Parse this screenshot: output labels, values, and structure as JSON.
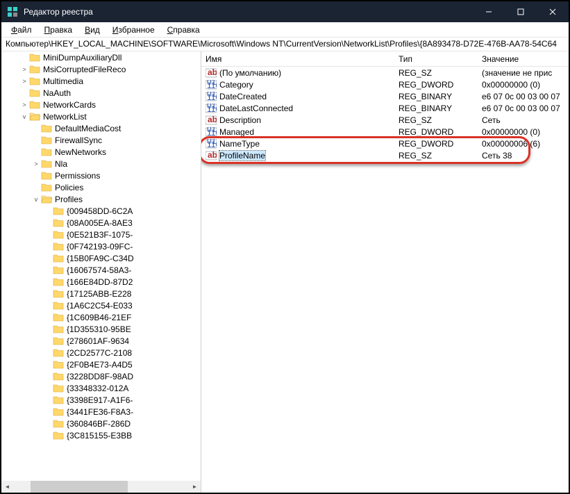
{
  "title": "Редактор реестра",
  "menu": {
    "file": "Файл",
    "edit": "Правка",
    "view": "Вид",
    "favorites": "Избранное",
    "help": "Справка"
  },
  "address": "Компьютер\\HKEY_LOCAL_MACHINE\\SOFTWARE\\Microsoft\\Windows NT\\CurrentVersion\\NetworkList\\Profiles\\{8A893478-D72E-476B-AA78-54C64",
  "columns": {
    "name": "Имя",
    "type": "Тип",
    "value": "Значение"
  },
  "tree": [
    {
      "indent": 8,
      "toggle": "",
      "label": "MiniDumpAuxiliaryDll"
    },
    {
      "indent": 8,
      "toggle": ">",
      "label": "MsiCorruptedFileReco"
    },
    {
      "indent": 8,
      "toggle": ">",
      "label": "Multimedia"
    },
    {
      "indent": 8,
      "toggle": "",
      "label": "NaAuth"
    },
    {
      "indent": 8,
      "toggle": ">",
      "label": "NetworkCards"
    },
    {
      "indent": 8,
      "toggle": "v",
      "label": "NetworkList"
    },
    {
      "indent": 9,
      "toggle": "",
      "label": "DefaultMediaCost"
    },
    {
      "indent": 9,
      "toggle": "",
      "label": "FirewallSync"
    },
    {
      "indent": 9,
      "toggle": "",
      "label": "NewNetworks"
    },
    {
      "indent": 9,
      "toggle": ">",
      "label": "Nla"
    },
    {
      "indent": 9,
      "toggle": "",
      "label": "Permissions"
    },
    {
      "indent": 9,
      "toggle": "",
      "label": "Policies"
    },
    {
      "indent": 9,
      "toggle": "v",
      "label": "Profiles"
    },
    {
      "indent": 10,
      "toggle": "",
      "label": "{009458DD-6C2A"
    },
    {
      "indent": 10,
      "toggle": "",
      "label": "{08A005EA-8AE3"
    },
    {
      "indent": 10,
      "toggle": "",
      "label": "{0E521B3F-1075-"
    },
    {
      "indent": 10,
      "toggle": "",
      "label": "{0F742193-09FC-"
    },
    {
      "indent": 10,
      "toggle": "",
      "label": "{15B0FA9C-C34D"
    },
    {
      "indent": 10,
      "toggle": "",
      "label": "{16067574-58A3-"
    },
    {
      "indent": 10,
      "toggle": "",
      "label": "{166E84DD-87D2"
    },
    {
      "indent": 10,
      "toggle": "",
      "label": "{17125ABB-E228"
    },
    {
      "indent": 10,
      "toggle": "",
      "label": "{1A6C2C54-E033"
    },
    {
      "indent": 10,
      "toggle": "",
      "label": "{1C609B46-21EF"
    },
    {
      "indent": 10,
      "toggle": "",
      "label": "{1D355310-95BE"
    },
    {
      "indent": 10,
      "toggle": "",
      "label": "{278601AF-9634"
    },
    {
      "indent": 10,
      "toggle": "",
      "label": "{2CD2577C-2108"
    },
    {
      "indent": 10,
      "toggle": "",
      "label": "{2F0B4E73-A4D5"
    },
    {
      "indent": 10,
      "toggle": "",
      "label": "{3228DD8F-98AD"
    },
    {
      "indent": 10,
      "toggle": "",
      "label": "{33348332-012A"
    },
    {
      "indent": 10,
      "toggle": "",
      "label": "{3398E917-A1F6-"
    },
    {
      "indent": 10,
      "toggle": "",
      "label": "{3441FE36-F8A3-"
    },
    {
      "indent": 10,
      "toggle": "",
      "label": "{360846BF-286D"
    },
    {
      "indent": 10,
      "toggle": "",
      "label": "{3C815155-E3BB"
    }
  ],
  "values": [
    {
      "kind": "sz",
      "name": "(По умолчанию)",
      "type": "REG_SZ",
      "value": "(значение не прис",
      "selected": false
    },
    {
      "kind": "bin",
      "name": "Category",
      "type": "REG_DWORD",
      "value": "0x00000000 (0)",
      "selected": false
    },
    {
      "kind": "bin",
      "name": "DateCreated",
      "type": "REG_BINARY",
      "value": "e6 07 0c 00 03 00 07",
      "selected": false
    },
    {
      "kind": "bin",
      "name": "DateLastConnected",
      "type": "REG_BINARY",
      "value": "e6 07 0c 00 03 00 07",
      "selected": false
    },
    {
      "kind": "sz",
      "name": "Description",
      "type": "REG_SZ",
      "value": "Сеть",
      "selected": false
    },
    {
      "kind": "bin",
      "name": "Managed",
      "type": "REG_DWORD",
      "value": "0x00000000 (0)",
      "selected": false
    },
    {
      "kind": "bin",
      "name": "NameType",
      "type": "REG_DWORD",
      "value": "0x00000006 (6)",
      "selected": false
    },
    {
      "kind": "sz",
      "name": "ProfileName",
      "type": "REG_SZ",
      "value": "Сеть 38",
      "selected": true
    }
  ],
  "highlightRow": 7
}
